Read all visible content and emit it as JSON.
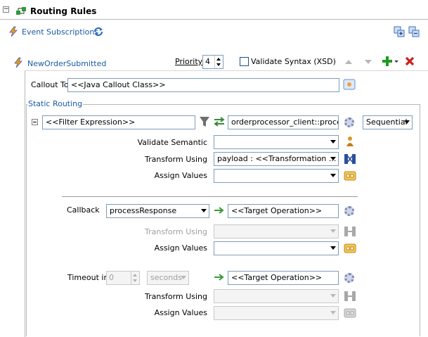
{
  "header": {
    "collapse_glyph": "−",
    "title": "Routing Rules"
  },
  "subscriptions": {
    "label": "Event Subscriptions"
  },
  "rule": {
    "name": "NewOrderSubmitted",
    "priority_label": "Priority",
    "priority_value": "4",
    "validate_syntax_label": "Validate Syntax (XSD)",
    "validate_syntax_checked": false,
    "callout_label": "Callout To",
    "callout_value": "<<Java Callout Class>>"
  },
  "static_routing": {
    "legend": "Static Routing",
    "filter_value": "<<Filter Expression>>",
    "target_value": "orderprocessor_client::process",
    "execution_value": "Sequential",
    "validate_semantic_label": "Validate Semantic",
    "validate_semantic_value": "",
    "transform_using_label": "Transform Using",
    "transform_using_value": "payload : <<Transformation ...",
    "assign_values_label": "Assign Values",
    "assign_values_value": ""
  },
  "callback": {
    "label": "Callback",
    "value": "processResponse",
    "target_value": "<<Target Operation>>",
    "transform_using_label": "Transform Using",
    "transform_using_value": "",
    "assign_values_label": "Assign Values",
    "assign_values_value": ""
  },
  "timeout": {
    "label": "Timeout in",
    "value": "0",
    "unit_value": "seconds",
    "target_value": "<<Target Operation>>",
    "transform_using_label": "Transform Using",
    "transform_using_value": "",
    "assign_values_label": "Assign Values",
    "assign_values_value": ""
  },
  "icons": {
    "lightning": "lightning-icon",
    "refresh": "refresh-icon",
    "expand_all": "expand-all-icon",
    "collapse_all": "collapse-all-icon",
    "move_up": "arrow-up-icon",
    "move_down": "arrow-down-icon",
    "add": "add-icon",
    "delete": "delete-icon"
  },
  "colors": {
    "link": "#1a5aa8",
    "add_green": "#1e9a1e",
    "delete_red": "#d11c1c"
  }
}
